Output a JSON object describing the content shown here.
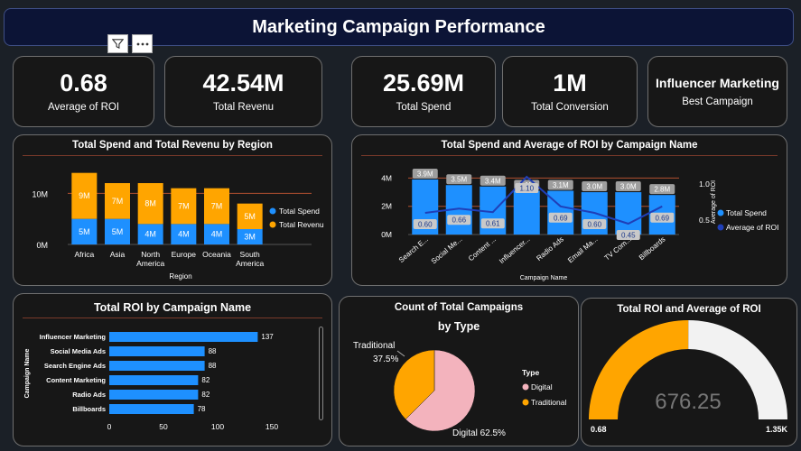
{
  "header": {
    "title": "Marketing Campaign Performance"
  },
  "kpis": [
    {
      "value": "0.68",
      "label": "Average of ROI"
    },
    {
      "value": "42.54M",
      "label": "Total Revenu"
    },
    {
      "value": "25.69M",
      "label": "Total Spend"
    },
    {
      "value": "1M",
      "label": "Total Conversion"
    },
    {
      "value": "Influencer Marketing",
      "label": "Best Campaign"
    }
  ],
  "colors": {
    "spend": "#1e90ff",
    "revenue": "#ffa500",
    "roi_line": "#1f3fb8",
    "digital": "#f3b3bd",
    "traditional": "#ffa500",
    "gauge_track": "#f2f2f2"
  },
  "chart_data": [
    {
      "id": "region",
      "type": "bar",
      "title": "Total Spend and Total Revenu by Region",
      "xlabel": "Region",
      "ylabel": "",
      "categories": [
        "Africa",
        "Asia",
        "North America",
        "Europe",
        "Oceania",
        "South America"
      ],
      "series": [
        {
          "name": "Total Spend",
          "values": [
            5,
            5,
            4,
            4,
            4,
            3
          ],
          "labels": [
            "5M",
            "5M",
            "4M",
            "4M",
            "4M",
            "3M"
          ]
        },
        {
          "name": "Total Revenu",
          "values": [
            9,
            7,
            8,
            7,
            7,
            5
          ],
          "labels": [
            "9M",
            "7M",
            "8M",
            "7M",
            "7M",
            "5M"
          ]
        }
      ],
      "yticks": [
        "0M",
        "10M"
      ],
      "ylim": [
        0,
        15
      ]
    },
    {
      "id": "campaign",
      "type": "bar",
      "title": "Total Spend and Average of ROI by Campaign Name",
      "xlabel": "Campaign Name",
      "ylabel": "",
      "categories": [
        "Search E...",
        "Social Me...",
        "Content ...",
        "Influencer...",
        "Radio Ads",
        "Email Ma...",
        "TV Com...",
        "Billboards"
      ],
      "series": [
        {
          "name": "Total Spend",
          "values": [
            3.9,
            3.5,
            3.4,
            3.1,
            3.1,
            3.0,
            3.0,
            2.8
          ],
          "labels": [
            "3.9M",
            "3.5M",
            "3.4M",
            "3.1M",
            "3.1M",
            "3.0M",
            "3.0M",
            "2.8M"
          ]
        },
        {
          "name": "Average of ROI",
          "values": [
            0.6,
            0.66,
            0.61,
            1.1,
            0.69,
            0.6,
            0.45,
            0.69
          ],
          "labels": [
            "0.60",
            "0.66",
            "0.61",
            "1.10",
            "0.69",
            "0.60",
            "0.45",
            "0.69"
          ]
        }
      ],
      "yticks_left": [
        "0M",
        "2M",
        "4M"
      ],
      "yticks_right": [
        "0.5",
        "1.0"
      ],
      "y2label": "Average of ROI",
      "ylim": [
        0,
        4.6
      ],
      "y2lim": [
        0.3,
        1.2
      ]
    },
    {
      "id": "roi_by_campaign",
      "type": "bar",
      "title": "Total ROI by Campaign Name",
      "ylabel": "Campaign Name",
      "categories": [
        "Influencer Marketing",
        "Social Media Ads",
        "Search Engine Ads",
        "Content Marketing",
        "Radio Ads",
        "Billboards"
      ],
      "values": [
        137,
        88,
        88,
        82,
        82,
        78
      ],
      "xticks": [
        "0",
        "50",
        "100",
        "150"
      ],
      "xlim": [
        0,
        150
      ]
    },
    {
      "id": "campaign_type",
      "type": "pie",
      "title_line1": "Count of Total Campaigns",
      "title_line2": "by Type",
      "legend_title": "Type",
      "slices": [
        {
          "name": "Digital",
          "value": 62.5,
          "label": "Digital 62.5%"
        },
        {
          "name": "Traditional",
          "value": 37.5,
          "label_name": "Traditional",
          "label_pct": "37.5%"
        }
      ]
    },
    {
      "id": "roi_gauge",
      "type": "gauge",
      "title": "Total ROI and Average of ROI",
      "value": 676.25,
      "value_label": "676.25",
      "target": 0.68,
      "min_label": "0.68",
      "max_label": "1.35K",
      "min": 0,
      "max": 1350
    }
  ]
}
